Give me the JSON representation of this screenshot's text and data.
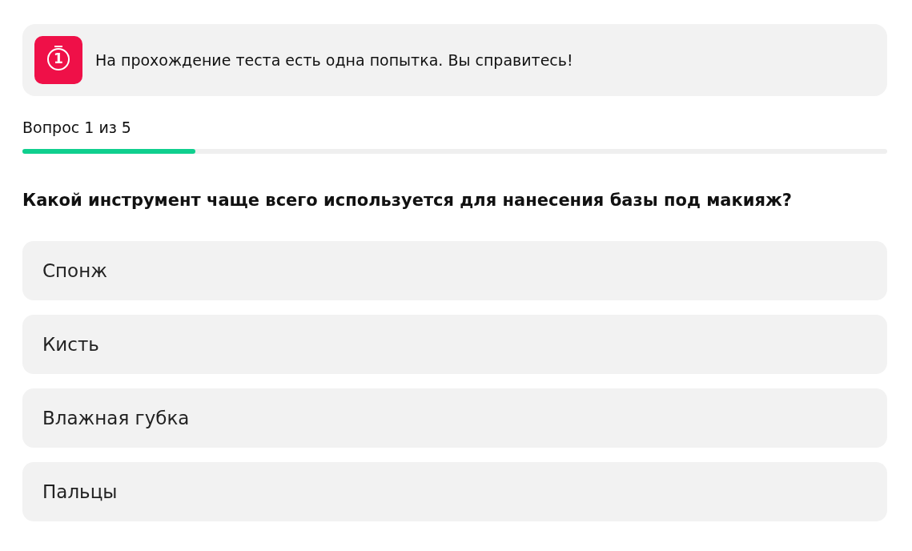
{
  "notice": {
    "badge": "1",
    "text": "На прохождение теста есть одна попытка. Вы справитесь!"
  },
  "progress": {
    "label": "Вопрос 1 из 5",
    "level": 0.2
  },
  "question": "Какой инструмент чаще всего используется для нанесения базы под макияж?",
  "options": [
    {
      "label": "Спонж",
      "selected": false
    },
    {
      "label": "Кисть",
      "selected": false
    },
    {
      "label": "Влажная губка",
      "selected": false
    },
    {
      "label": "Пальцы",
      "selected": false
    }
  ]
}
